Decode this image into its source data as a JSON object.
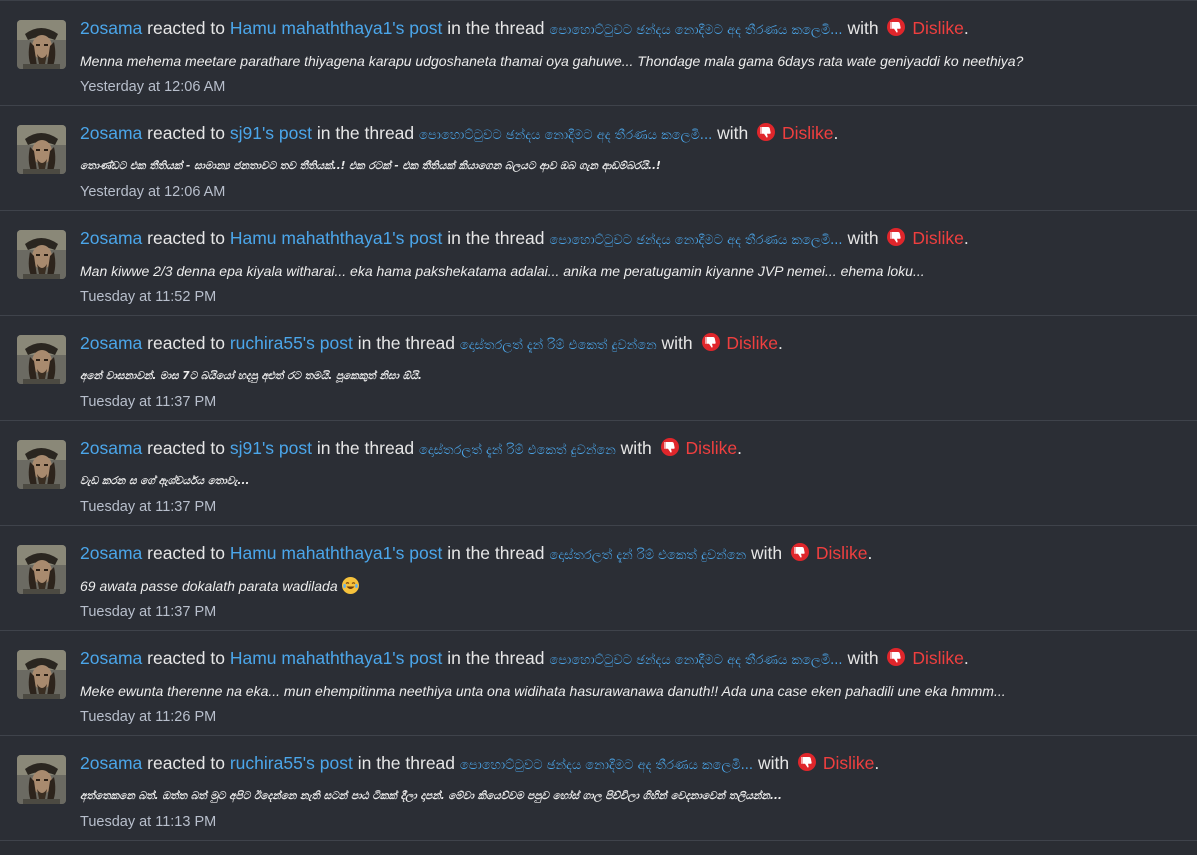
{
  "items": [
    {
      "user": "2osama",
      "reacted_to": "reacted to",
      "post_owner": "Hamu mahaththaya1's post",
      "in_thread": "in the thread",
      "thread": "පොහොට්ටුවට ඡන්දය නොදීමට අද තීරණය කලෙමි...",
      "with": "with",
      "reaction": "Dislike",
      "period": ".",
      "snippet": "Menna mehema meetare parathare thiyagena karapu udgoshaneta thamai oya gahuwe... Thondage mala gama 6days rata wate geniyaddi ko neethiya?",
      "time": "Yesterday at 12:06 AM"
    },
    {
      "user": "2osama",
      "reacted_to": "reacted to",
      "post_owner": "sj91's post",
      "in_thread": "in the thread",
      "thread": "පොහොට්ටුවට ඡන්දය නොදීමට අද තීරණය කලෙමි...",
      "with": "with",
      "reaction": "Dislike",
      "period": ".",
      "snippet": "තොණ්ඩට එක තීතියක් - සාමාන්‍ය ජනතාවට තව තීතියක්..! එක රටක් - එක තීතියක් කියාගෙන බලයට ආව ඔබ ගැන ආඩම්බරයි..!",
      "time": "Yesterday at 12:06 AM"
    },
    {
      "user": "2osama",
      "reacted_to": "reacted to",
      "post_owner": "Hamu mahaththaya1's post",
      "in_thread": "in the thread",
      "thread": "පොහොට්ටුවට ඡන්දය නොදීමට අද තීරණය කලෙමි...",
      "with": "with",
      "reaction": "Dislike",
      "period": ".",
      "snippet": "Man kiwwe 2/3 denna epa kiyala witharai... eka hama pakshekatama adalai... anika me peratugamin kiyanne JVP nemei... ehema loku...",
      "time": "Tuesday at 11:52 PM"
    },
    {
      "user": "2osama",
      "reacted_to": "reacted to",
      "post_owner": "ruchira55's post",
      "in_thread": "in the thread",
      "thread": "දොස්තරලත් දැන් රිම් එකෙත් දුවන්නෙ",
      "with": "with",
      "reaction": "Dislike",
      "period": ".",
      "snippet": "අනේ වාසනාවන්. මාස 7ට බයියෝ හදපු අළුත් රට තමයි. පූකෙකුත් නිසා ඕයි.",
      "time": "Tuesday at 11:37 PM"
    },
    {
      "user": "2osama",
      "reacted_to": "reacted to",
      "post_owner": "sj91's post",
      "in_thread": "in the thread",
      "thread": "දොස්තරලත් දැන් රිම් එකෙත් දුවන්නෙ",
      "with": "with",
      "reaction": "Dislike",
      "period": ".",
      "snippet": "වැඩ කරන ස ගේ ඇශ්චර්යය තොවැ...",
      "time": "Tuesday at 11:37 PM"
    },
    {
      "user": "2osama",
      "reacted_to": "reacted to",
      "post_owner": "Hamu mahaththaya1's post",
      "in_thread": "in the thread",
      "thread": "දොස්තරලත් දැන් රිම් එකෙත් දුවන්නෙ",
      "with": "with",
      "reaction": "Dislike",
      "period": ".",
      "snippet": "69 awata passe dokalath parata wadilada",
      "snippet_emoji": "laughing-tears-emoji",
      "time": "Tuesday at 11:37 PM"
    },
    {
      "user": "2osama",
      "reacted_to": "reacted to",
      "post_owner": "Hamu mahaththaya1's post",
      "in_thread": "in the thread",
      "thread": "පොහොට්ටුවට ඡන්දය නොදීමට අද තීරණය කලෙමි...",
      "with": "with",
      "reaction": "Dislike",
      "period": ".",
      "snippet": "Meke ewunta therenne na eka... mun ehempitinma neethiya unta ona widihata hasurawanawa danuth!! Ada una case eken pahadili une eka hmmm...",
      "time": "Tuesday at 11:26 PM"
    },
    {
      "user": "2osama",
      "reacted_to": "reacted to",
      "post_owner": "ruchira55's post",
      "in_thread": "in the thread",
      "thread": "පොහොට්ටුවට ඡන්දය නොදීමට අද තීරණය කලෙමි...",
      "with": "with",
      "reaction": "Dislike",
      "period": ".",
      "snippet": "අත්තෙකනෙ බත්. ඔත්ත බත් මුට අපිට ඊදෙන්නෙ නැති සටන් පාඨ ටිකක් දීලා දාපන්. මේවා කියෙව්වම පපුව හෝස් ගාල පිච්චිලා ගිහින් වෙදනාවෙන් තලියන්න...",
      "time": "Tuesday at 11:13 PM"
    }
  ],
  "colors": {
    "background": "#2b2e35",
    "link": "#4ba6ea",
    "dislike": "#ef3f3f",
    "time": "#b8bfcc"
  }
}
